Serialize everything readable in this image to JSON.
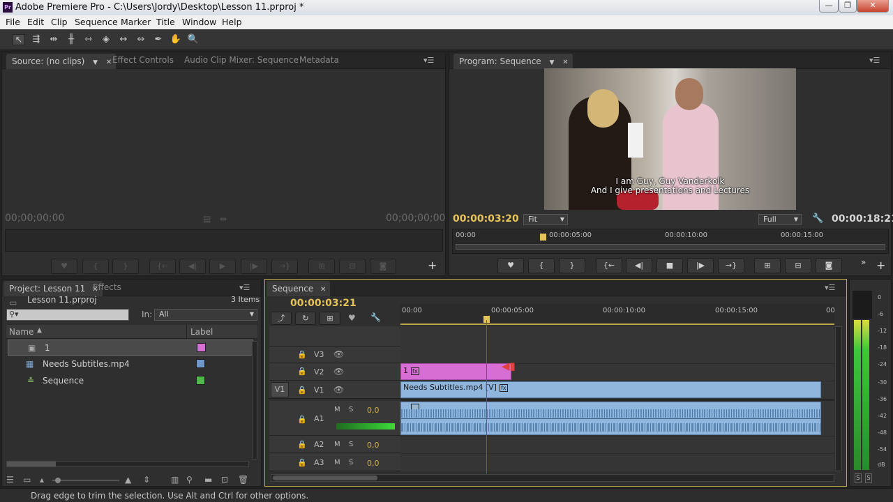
{
  "window": {
    "title": "Adobe Premiere Pro - C:\\Users\\Jordy\\Desktop\\Lesson 11.prproj *",
    "logo": "Pr",
    "minimize": "—",
    "maximize": "❐",
    "close": "✕"
  },
  "menu": [
    "File",
    "Edit",
    "Clip",
    "Sequence",
    "Marker",
    "Title",
    "Window",
    "Help"
  ],
  "tools": [
    {
      "name": "selection-tool-icon",
      "glyph": "↖"
    },
    {
      "name": "track-select-tool-icon",
      "glyph": "⇶"
    },
    {
      "name": "ripple-edit-tool-icon",
      "glyph": "⇹"
    },
    {
      "name": "rolling-edit-tool-icon",
      "glyph": "╫"
    },
    {
      "name": "rate-stretch-tool-icon",
      "glyph": "⇿"
    },
    {
      "name": "razor-tool-icon",
      "glyph": "◈"
    },
    {
      "name": "slip-tool-icon",
      "glyph": "↔"
    },
    {
      "name": "slide-tool-icon",
      "glyph": "⇔"
    },
    {
      "name": "pen-tool-icon",
      "glyph": "✒"
    },
    {
      "name": "hand-tool-icon",
      "glyph": "✋"
    },
    {
      "name": "zoom-tool-icon",
      "glyph": "🔍"
    }
  ],
  "source_panel": {
    "tabs": [
      "Source: (no clips)",
      "Effect Controls",
      "Audio Clip Mixer: Sequence",
      "Metadata"
    ],
    "timecode_in": "00;00;00;00",
    "timecode_out": "00;00;00;00"
  },
  "program_panel": {
    "tab": "Program: Sequence",
    "timecode_current": "00:00:03:20",
    "fit_select": "Fit",
    "quality_select": "Full",
    "timecode_duration": "00:00:18:21",
    "ruler": [
      "00:00",
      "00:00:05:00",
      "00:00:10:00",
      "00:00:15:00"
    ],
    "subtitle_line1": "I am Guy, Guy Vanderkolk",
    "subtitle_line2": "And I give presentations and Lectures"
  },
  "project_panel": {
    "tabs": [
      "Project: Lesson 11",
      "Effects"
    ],
    "file": "Lesson 11.prproj",
    "count": "3 Items",
    "search_placeholder": "",
    "in_label": "In:",
    "in_value": "All",
    "col_name": "Name",
    "col_label": "Label",
    "items": [
      {
        "name": "1",
        "color": "#d76ed3"
      },
      {
        "name": "Needs Subtitles.mp4",
        "color": "#6f97c9"
      },
      {
        "name": "Sequence",
        "color": "#4fb84a"
      }
    ]
  },
  "timeline": {
    "tab": "Sequence",
    "timecode": "00:00:03:21",
    "ruler": [
      "00:00",
      "00:00:05:00",
      "00:00:10:00",
      "00:00:15:00",
      "00"
    ],
    "tracks": {
      "v3": "V3",
      "v2": "V2",
      "v1": "V1",
      "v1_source": "V1",
      "a1": "A1",
      "a2": "A2",
      "a3": "A3",
      "m": "M",
      "s": "S",
      "vol": "0,0"
    },
    "clip_pink": "1",
    "clip_video": "Needs Subtitles.mp4 [V]"
  },
  "meter": {
    "labels": [
      "0",
      "-6",
      "-12",
      "-18",
      "-24",
      "-30",
      "-36",
      "-42",
      "-48",
      "-54",
      "dB"
    ],
    "solo_left": "S",
    "solo_right": "S"
  },
  "status": "Drag edge to trim the selection. Use Alt and Ctrl for other options.",
  "colors": {
    "accent_yellow": "#e6c35a",
    "clip_pink": "#d76ed3",
    "clip_blue": "#8fb7de",
    "playhead": "#d03030"
  }
}
